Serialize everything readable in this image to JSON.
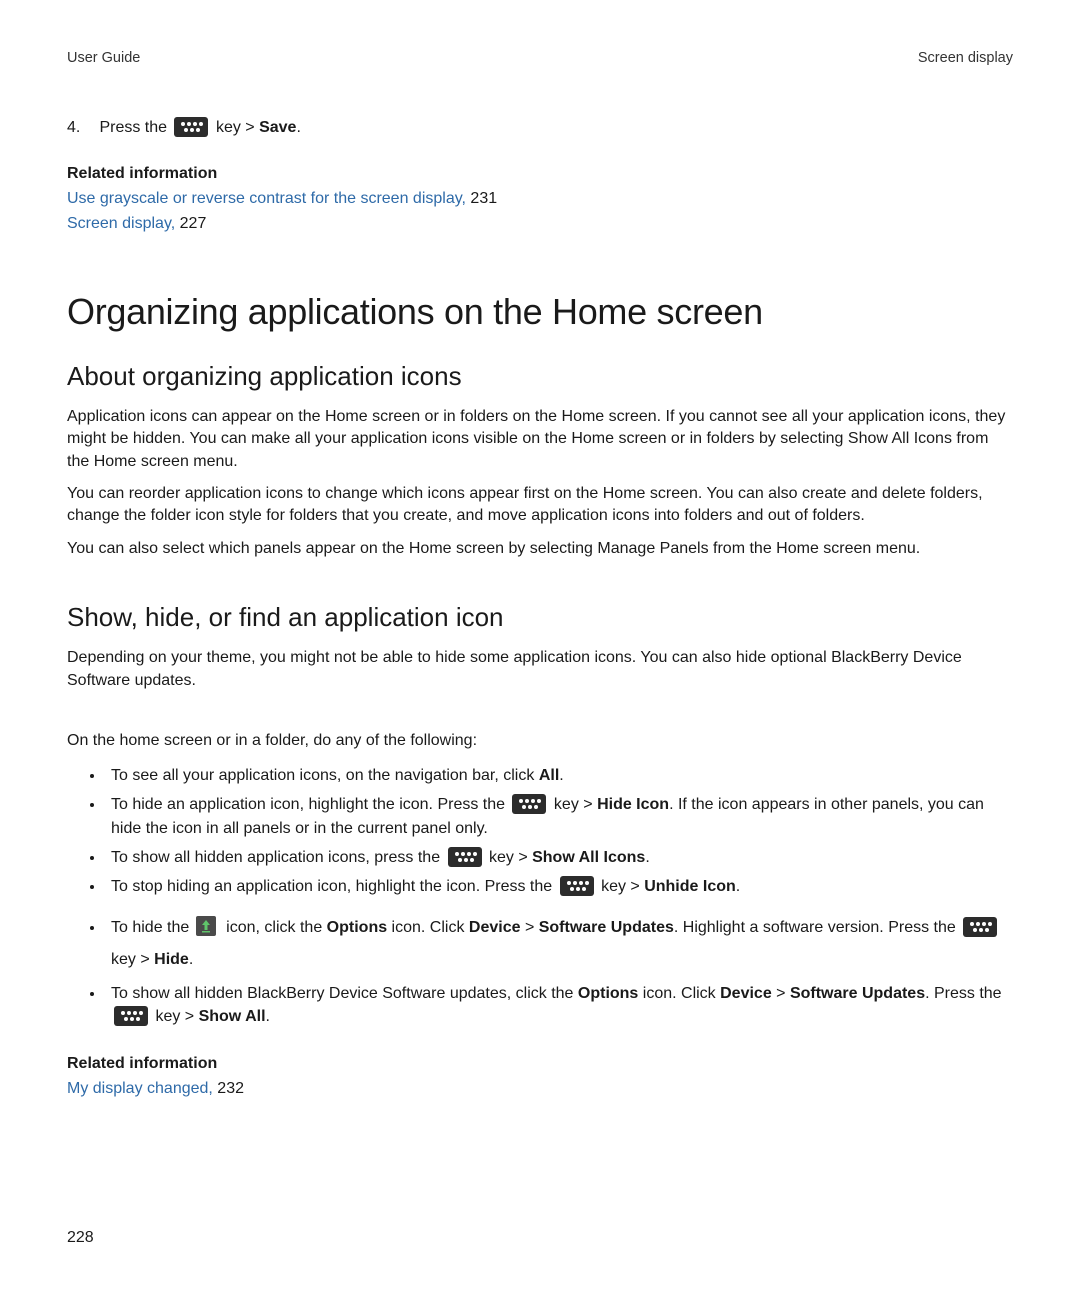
{
  "header": {
    "left": "User Guide",
    "right": "Screen display"
  },
  "step4": {
    "num": "4.",
    "pre": "Press the ",
    "mid": " key > ",
    "action": "Save",
    "end": "."
  },
  "related1": {
    "heading": "Related information",
    "link1": "Use grayscale or reverse contrast for the screen display,",
    "page1": " 231",
    "link2": "Screen display,",
    "page2": " 227"
  },
  "h1": "Organizing applications on the Home screen",
  "h2a": "About organizing application icons",
  "p1": "Application icons can appear on the Home screen or in folders on the Home screen. If you cannot see all your application icons, they might be hidden. You can make all your application icons visible on the Home screen or in folders by selecting Show All Icons from the Home screen menu.",
  "p2": "You can reorder application icons to change which icons appear first on the Home screen. You can also create and delete folders, change the folder icon style for folders that you create, and move application icons into folders and out of folders.",
  "p3": "You can also select which panels appear on the Home screen by selecting Manage Panels from the Home screen menu.",
  "h2b": "Show, hide, or find an application icon",
  "p4": "Depending on your theme, you might not be able to hide some application icons. You can also hide optional BlackBerry Device Software updates.",
  "p5": "On the home screen or in a folder, do any of the following:",
  "b1": {
    "pre": "To see all your application icons, on the navigation bar, click ",
    "b": "All",
    "end": "."
  },
  "b2": {
    "pre": "To hide an application icon, highlight the icon. Press the ",
    "mid": " key > ",
    "b": "Hide Icon",
    "rest": ". If the icon appears in other panels, you can hide the icon in all panels or in the current panel only."
  },
  "b3": {
    "pre": "To show all hidden application icons, press the ",
    "mid": " key > ",
    "b": "Show All Icons",
    "end": "."
  },
  "b4": {
    "pre": "To stop hiding an application icon, highlight the icon. Press the ",
    "mid": " key > ",
    "b": "Unhide Icon",
    "end": "."
  },
  "b5": {
    "pre": "To hide the ",
    "mid1": " icon, click the ",
    "opt": "Options",
    "mid2": " icon. Click ",
    "dev": "Device",
    "gt": " > ",
    "su": "Software Updates",
    "rest1": ". Highlight a software version. Press the ",
    "mid3": " key > ",
    "hide": "Hide",
    "end": "."
  },
  "b6": {
    "pre": "To show all hidden BlackBerry Device Software updates, click the ",
    "opt": "Options",
    "mid1": " icon. Click ",
    "dev": "Device",
    "gt": " > ",
    "su": "Software Updates",
    "rest": ". Press the ",
    "mid2": " key > ",
    "sa": "Show All",
    "end": "."
  },
  "related2": {
    "heading": "Related information",
    "link": "My display changed,",
    "page": " 232"
  },
  "pagenum": "228"
}
